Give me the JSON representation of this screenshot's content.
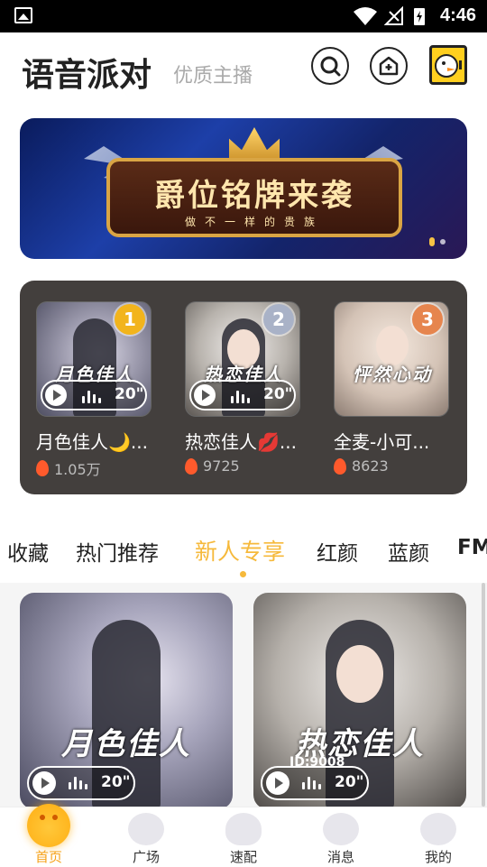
{
  "status_bar": {
    "time": "4:46"
  },
  "header": {
    "title": "语音派对",
    "subtitle": "优质主播"
  },
  "banner": {
    "title": "爵位铭牌来袭",
    "subtitle": "做不一样的贵族"
  },
  "rankings": [
    {
      "rank": "1",
      "name": "月色佳人🌙...",
      "heat": "1.05万",
      "overlay": "月色佳人",
      "duration": "20\""
    },
    {
      "rank": "2",
      "name": "热恋佳人💋...",
      "heat": "9725",
      "overlay": "热恋佳人",
      "duration": "20\""
    },
    {
      "rank": "3",
      "name": "全麦-小可...",
      "heat": "8623",
      "overlay": "怦然心动",
      "duration": ""
    }
  ],
  "tabs": [
    {
      "label": "收藏"
    },
    {
      "label": "热门推荐"
    },
    {
      "label": "新人专享"
    },
    {
      "label": "红颜"
    },
    {
      "label": "蓝颜"
    },
    {
      "label": "FM"
    }
  ],
  "active_tab": "新人专享",
  "cards": [
    {
      "overlay": "月色佳人",
      "duration": "20\"",
      "id_text": ""
    },
    {
      "overlay": "热恋佳人",
      "duration": "20\"",
      "id_text": "ID:9008"
    }
  ],
  "bottom_nav": [
    {
      "label": "首页",
      "active": true
    },
    {
      "label": "广场"
    },
    {
      "label": "速配"
    },
    {
      "label": "消息"
    },
    {
      "label": "我的"
    }
  ],
  "colors": {
    "accent": "#f6b93b",
    "rank_panel": "#433f3d",
    "gold": "#f2b41c",
    "silver": "#a9b2c7",
    "bronze": "#e6854e"
  }
}
